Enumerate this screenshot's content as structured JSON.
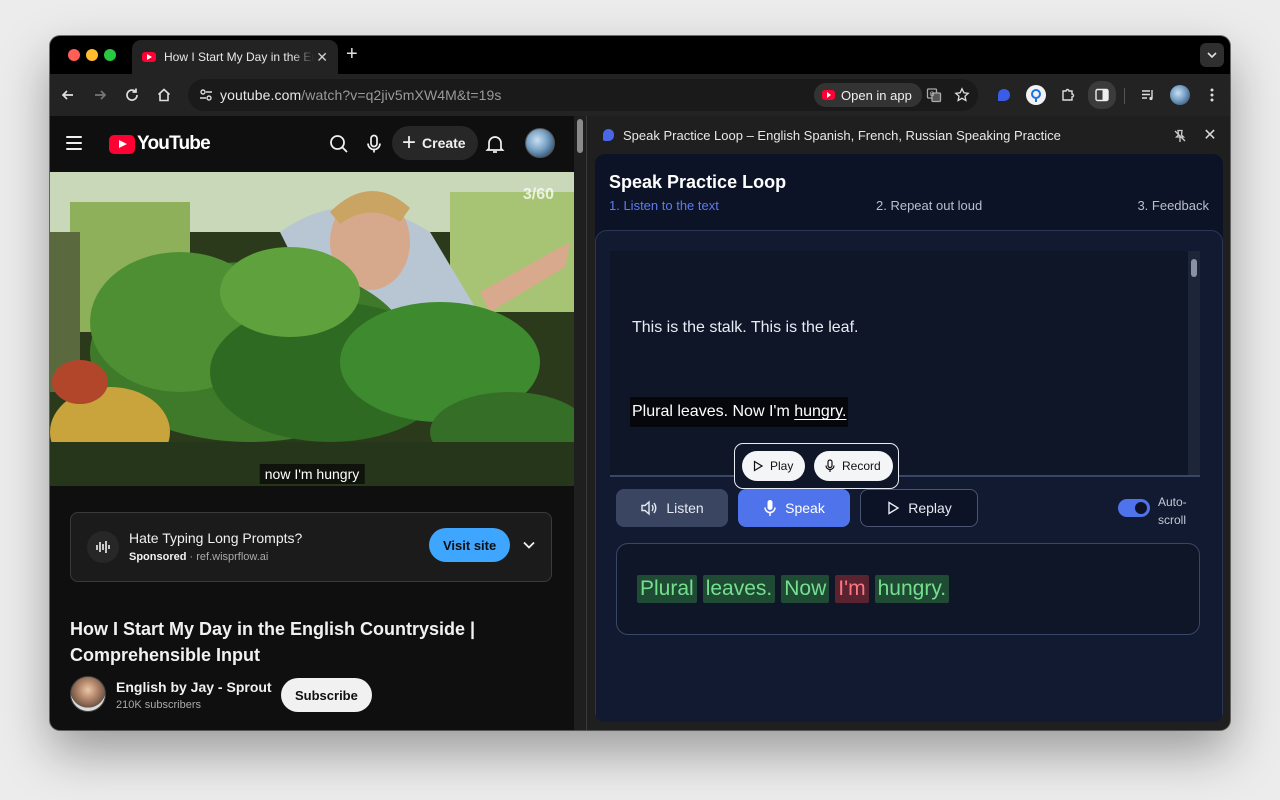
{
  "browser": {
    "tab_title": "How I Start My Day in the English Countryside | Comprehensible Input",
    "url_host": "youtube.com",
    "url_path": "/watch?v=q2jiv5mXW4M&t=19s",
    "open_in_app": "Open in app"
  },
  "youtube": {
    "logo_text": "YouTube",
    "create_label": "Create",
    "video_counter": "3/60",
    "caption": "now I'm hungry",
    "ad": {
      "title": "Hate Typing Long Prompts?",
      "sponsored": "Sponsored",
      "domain": "ref.wisprflow.ai",
      "cta": "Visit site"
    },
    "video_title": "How I Start My Day in the English Countryside | Comprehensible Input",
    "channel_name": "English by Jay - Sprout",
    "subscribers": "210K subscribers",
    "subscribe_label": "Subscribe"
  },
  "side_panel": {
    "title": "Speak Practice Loop – English Spanish, French, Russian Speaking Practice",
    "app_title": "Speak Practice Loop",
    "steps": [
      "1. Listen to the text",
      "2. Repeat out loud",
      "3. Feedback"
    ],
    "active_step": 0,
    "text_line_1": "This is the stalk. This is the leaf.",
    "text_line_2_prefix": "Plural leaves. Now I'm ",
    "text_line_2_underlined": "hungry.",
    "popup": {
      "play": "Play",
      "record": "Record"
    },
    "controls": {
      "listen": "Listen",
      "speak": "Speak",
      "replay": "Replay"
    },
    "autoscroll_label": "Auto-scroll",
    "autoscroll_on": true,
    "feedback_words": [
      {
        "text": "Plural",
        "status": "correct"
      },
      {
        "text": "leaves.",
        "status": "correct"
      },
      {
        "text": "Now",
        "status": "correct"
      },
      {
        "text": "I'm",
        "status": "incorrect"
      },
      {
        "text": "hungry.",
        "status": "correct"
      }
    ]
  },
  "colors": {
    "accent": "#4f73ea",
    "youtube_red": "#ff0033",
    "correct": "#74e08e",
    "incorrect": "#ff7683"
  }
}
